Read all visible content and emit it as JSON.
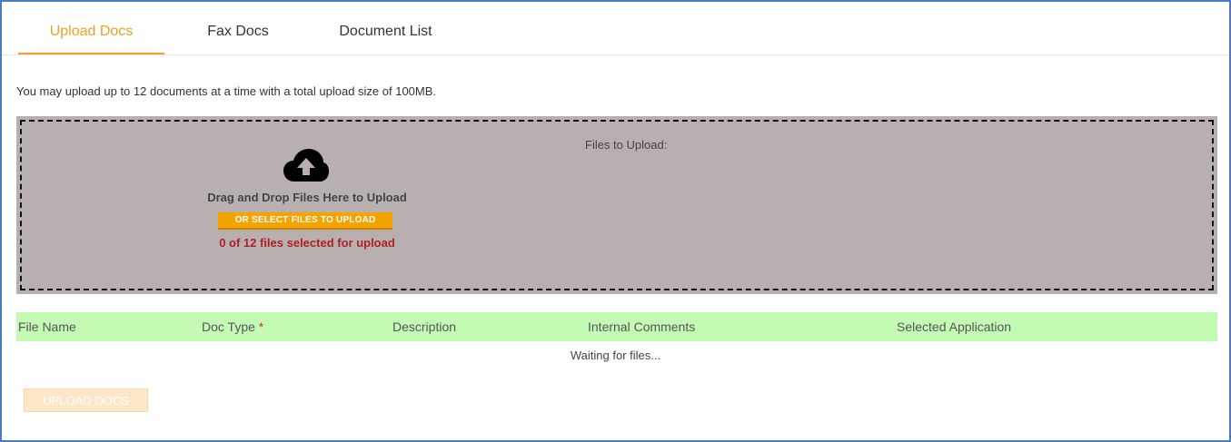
{
  "tabs": [
    {
      "label": "Upload Docs",
      "active": true
    },
    {
      "label": "Fax Docs",
      "active": false
    },
    {
      "label": "Document List",
      "active": false
    }
  ],
  "info_text": "You may upload up to 12 documents at a time with a total upload size of 100MB.",
  "dropzone": {
    "icon": "cloud-upload-icon",
    "title": "Drag and Drop Files Here to Upload",
    "select_button": "OR SELECT FILES TO UPLOAD",
    "count_text": "0 of 12 files selected for upload",
    "files_label": "Files to Upload:"
  },
  "table": {
    "columns": [
      "File Name",
      "Doc Type",
      "Description",
      "Internal Comments",
      "Selected Application"
    ],
    "required_marker": "*",
    "empty_text": "Waiting for files..."
  },
  "upload_button": "UPLOAD DOCS",
  "colors": {
    "accent": "#f0a022",
    "dropzone_bg": "#b8b0b0",
    "table_header_bg": "#c3fbb5",
    "count_text": "#b01f1f",
    "frame_border": "#4a7bc4"
  }
}
